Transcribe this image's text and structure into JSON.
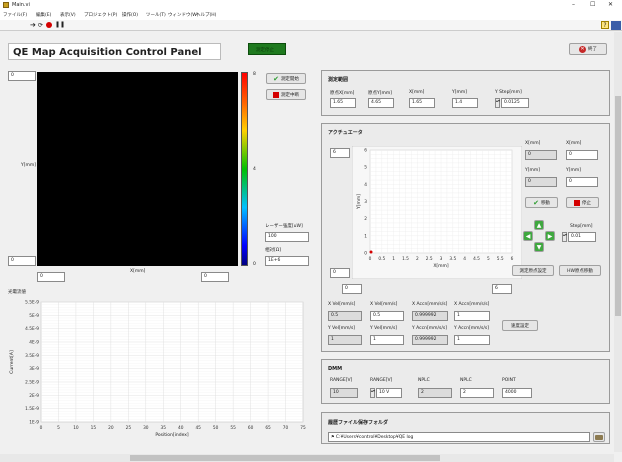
{
  "window": {
    "title": "Main.vi",
    "menu": [
      "ファイル(F)",
      "編集(E)",
      "表示(V)",
      "プロジェクト(P)",
      "操作(O)",
      "ツール(T)",
      "ウィンドウ(W)",
      "ヘルプ(H)"
    ],
    "minimize": "–",
    "maximize": "☐",
    "close": "✕"
  },
  "header": {
    "title": "QE Map Acquisition Control Panel",
    "status_indicator": "測定停止",
    "exit_label": "終了"
  },
  "map": {
    "corner_top": "0",
    "corner_bottom": "0",
    "y_label": "Y[mm]",
    "x_label": "X[mm]",
    "x_min": "0",
    "x_max": "0",
    "colorbar_ticks": [
      "8",
      "4",
      "0"
    ],
    "start_button": "測定開始",
    "stop_button": "測定中断",
    "laser_label": "レーザー強度[uW]",
    "laser_value": "100",
    "ratio_label": "相対[Ω]",
    "ratio_value": "1E+6"
  },
  "current_chart": {
    "title": "光電流値",
    "ylabel": "Current[A]",
    "xlabel": "Position[index]",
    "y_ticks": [
      "5.5E-9",
      "5E-9",
      "4.5E-9",
      "4E-9",
      "3.5E-9",
      "3E-9",
      "2.5E-9",
      "2E-9",
      "1.5E-9",
      "1E-9"
    ],
    "x_ticks": [
      "0",
      "5",
      "10",
      "15",
      "20",
      "25",
      "30",
      "35",
      "40",
      "45",
      "50",
      "55",
      "60",
      "65",
      "70",
      "75"
    ]
  },
  "range": {
    "title": "測定範囲",
    "fields": [
      {
        "label": "原点X[mm]",
        "value": "1.65"
      },
      {
        "label": "原点Y[mm]",
        "value": "4.65"
      },
      {
        "label": "X[mm]",
        "value": "1.65"
      },
      {
        "label": "Y[mm]",
        "value": "1.4"
      },
      {
        "label": "Y Step[mm]",
        "value": "0.0125"
      }
    ]
  },
  "actuator": {
    "title": "アクチュエータ",
    "y_top": "6",
    "y_bottom": "0",
    "x_left": "0",
    "x_right": "6",
    "xlabel": "X[mm]",
    "ylabel": "Y[mm]",
    "x_ticks": [
      "0",
      "0.5",
      "1",
      "1.5",
      "2",
      "2.5",
      "3",
      "3.5",
      "4",
      "4.5",
      "5",
      "5.5",
      "6"
    ],
    "y_ticks": [
      "6",
      "5",
      "4",
      "3",
      "2",
      "1",
      "0"
    ],
    "cur_x_label": "X[mm]",
    "cur_x_value": "0",
    "set_x_label": "X[mm]",
    "set_x_value": "0",
    "cur_y_label": "Y[mm]",
    "cur_y_value": "0",
    "set_y_label": "Y[mm]",
    "set_y_value": "0",
    "move_button": "移動",
    "stop_button": "停止",
    "step_label": "Step[mm]",
    "step_value": "0.01",
    "origin_set_button": "測定原点設定",
    "hw_origin_button": "HW原点移動",
    "speeds": [
      {
        "label": "X Vel[mm/s]",
        "value": "0.5"
      },
      {
        "label": "X Vel[mm/s]",
        "value": "0.5"
      },
      {
        "label": "X Accn[mm/s/s]",
        "value": "0.999992"
      },
      {
        "label": "X Accn[mm/s/s]",
        "value": "1"
      },
      {
        "label": "Y Vel[mm/s]",
        "value": "1"
      },
      {
        "label": "Y Vel[mm/s]",
        "value": "1"
      },
      {
        "label": "Y Accn[mm/s/s]",
        "value": "0.999992"
      },
      {
        "label": "Y Accn[mm/s/s]",
        "value": "1"
      }
    ],
    "speed_set_button": "速度設定"
  },
  "dmm": {
    "title": "DMM",
    "fields": [
      {
        "label": "RANGE[V]",
        "value": "10"
      },
      {
        "label": "RANGE[V]",
        "value": "10 V"
      },
      {
        "label": "NPLC",
        "value": "2"
      },
      {
        "label": "NPLC",
        "value": "2"
      },
      {
        "label": "POINT",
        "value": "4000"
      }
    ]
  },
  "log": {
    "title": "履歴ファイル保存フォルダ",
    "path": "C:¥Users¥control¥Desktop¥QE log"
  },
  "colors": {
    "accent_green": "#2e7d32",
    "indicator_green": "#1f7a1f",
    "stop_red": "#d40000",
    "exit_red": "#c62828"
  }
}
